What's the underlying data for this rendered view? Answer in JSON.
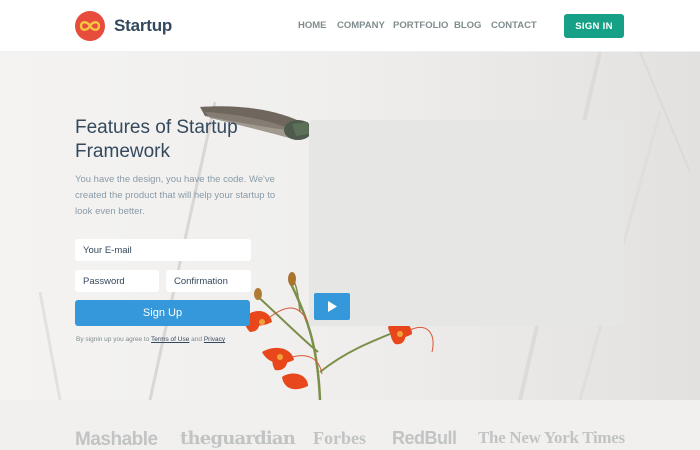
{
  "header": {
    "brand": "Startup",
    "nav": [
      "HOME",
      "COMPANY",
      "PORTFOLIO",
      "BLOG",
      "CONTACT"
    ],
    "signin_label": "SIGN IN"
  },
  "hero": {
    "title": "Features of Startup Framework",
    "description": "You have the design, you have the code. We've created the product that will help your startup to look even better.",
    "form": {
      "email_placeholder": "Your E-mail",
      "password_placeholder": "Password",
      "confirmation_placeholder": "Confirmation",
      "submit_label": "Sign Up",
      "terms_prefix": "By signin up you agree to ",
      "terms_link": "Terms of Use",
      "terms_and": " and ",
      "privacy_link": "Privacy"
    }
  },
  "press": {
    "logos": [
      "Mashable",
      "theguardian",
      "Forbes",
      "RedBull",
      "The New York Times"
    ]
  },
  "colors": {
    "logo": "#e74c3c",
    "signin": "#16a085",
    "primary": "#3498db",
    "text": "#34495e"
  },
  "icons": {
    "logo": "infinity-icon",
    "play": "play-icon"
  }
}
